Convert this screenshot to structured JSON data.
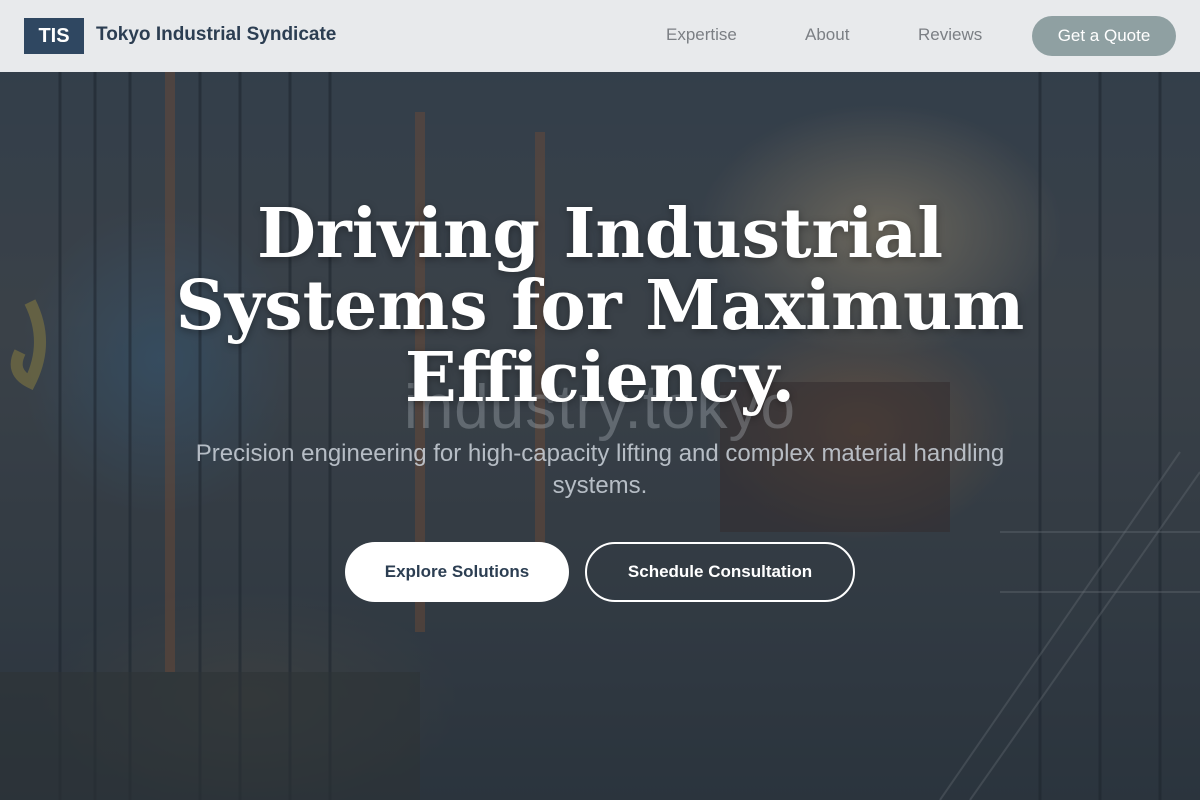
{
  "header": {
    "logo_text": "TIS",
    "brand_name": "Tokyo Industrial Syndicate",
    "nav": [
      {
        "label": "Expertise"
      },
      {
        "label": "About"
      },
      {
        "label": "Reviews"
      }
    ],
    "cta_label": "Get a Quote"
  },
  "hero": {
    "title": "Driving Industrial Systems for Maximum Efficiency.",
    "watermark": "industry.tokyo",
    "subtitle": "Precision engineering for high-capacity lifting and complex material handling systems.",
    "primary_button": "Explore Solutions",
    "secondary_button": "Schedule Consultation",
    "background_image": "industrial-factory-photo"
  },
  "colors": {
    "brand_navy": "#2f4761",
    "nav_background": "#eef0f2",
    "cta_background": "#8fa0a2",
    "hero_text": "#ffffff"
  }
}
